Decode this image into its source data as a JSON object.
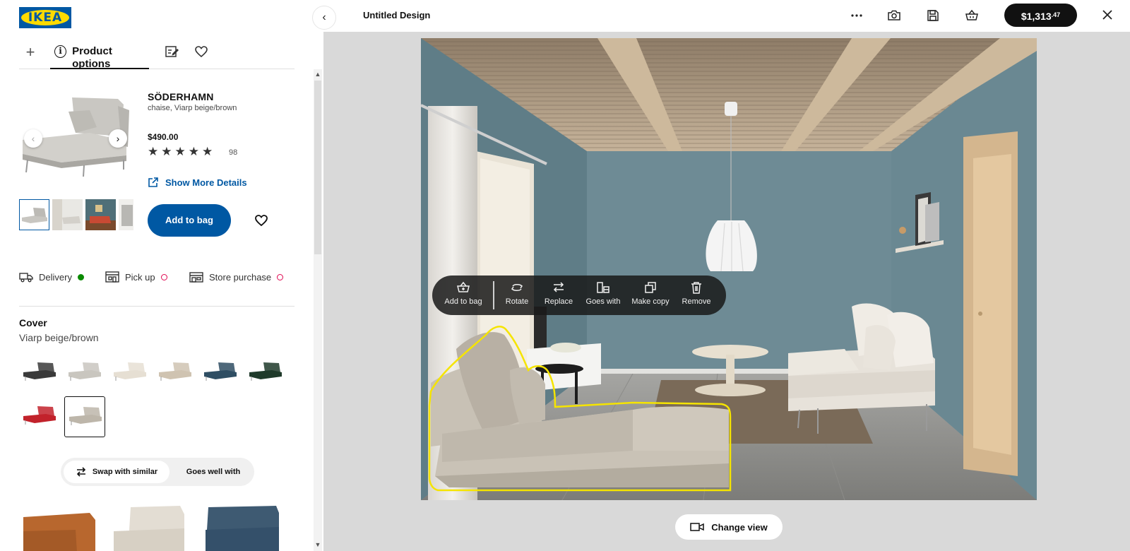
{
  "brand": {
    "logo_text": "IKEA",
    "colors": {
      "blue": "#0058a3",
      "yellow": "#ffdb00"
    }
  },
  "tabs": {
    "add_icon": "plus-icon",
    "active_label": "Product options",
    "active_icon": "info-icon",
    "others": [
      "edit-list-icon",
      "heart-icon"
    ]
  },
  "product": {
    "name": "SÖDERHAMN",
    "description": "chaise, Viarp beige/brown",
    "price": "$490.00",
    "rating": 5,
    "reviews": "98",
    "details_link": "Show More Details",
    "add_to_bag": "Add to bag",
    "image_count": 4
  },
  "availability": [
    {
      "label": "Delivery",
      "status": "available",
      "color": "#0a8a00",
      "icon": "truck-icon"
    },
    {
      "label": "Pick up",
      "status": "unavailable",
      "color": "#e00751",
      "icon": "pickup-icon"
    },
    {
      "label": "Store purchase",
      "status": "unavailable",
      "color": "#e00751",
      "icon": "store-icon"
    }
  ],
  "cover": {
    "title": "Cover",
    "value": "Viarp beige/brown",
    "swatches": [
      {
        "name": "dark grey",
        "color": "#3a3a3a"
      },
      {
        "name": "light grey",
        "color": "#c9c6bf"
      },
      {
        "name": "off-white",
        "color": "#e6dfd3"
      },
      {
        "name": "beige",
        "color": "#cfc3b1"
      },
      {
        "name": "blue",
        "color": "#2f4e63"
      },
      {
        "name": "dark green",
        "color": "#1f3a2a"
      },
      {
        "name": "red",
        "color": "#c2222b"
      },
      {
        "name": "beige/brown",
        "color": "#bdb6aa",
        "selected": true
      }
    ]
  },
  "swap": {
    "selected": "Swap with similar",
    "other": "Goes well with"
  },
  "suggestions": [
    {
      "color": "#b8672e"
    },
    {
      "color": "#e3ddd3"
    },
    {
      "color": "#3e5a72"
    }
  ],
  "topbar": {
    "title": "Untitled Design",
    "icons": [
      "more-icon",
      "camera-icon",
      "save-icon",
      "basket-icon"
    ],
    "price_main": "$1,313",
    "price_cents": ".47",
    "close_icon": "close-icon"
  },
  "toolbar": [
    {
      "label": "Add to bag",
      "icon": "basket-add-icon"
    },
    {
      "label": "Rotate",
      "icon": "rotate-icon"
    },
    {
      "label": "Replace",
      "icon": "replace-icon"
    },
    {
      "label": "Goes with",
      "icon": "goes-with-icon"
    },
    {
      "label": "Make copy",
      "icon": "copy-icon"
    },
    {
      "label": "Remove",
      "icon": "trash-icon"
    }
  ],
  "change_view": "Change view",
  "scene": {
    "wall_color": "#6f8d96",
    "floor_color": "#8f8f8c",
    "ceiling_color": "#b8a48c",
    "selection_color": "#f5e400"
  }
}
